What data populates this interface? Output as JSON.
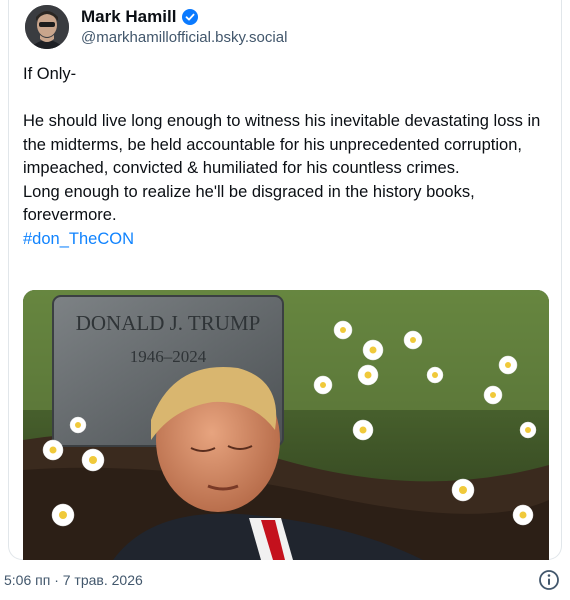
{
  "author": {
    "display_name": "Mark Hamill",
    "handle": "@markhamillofficial.bsky.social"
  },
  "post": {
    "line1": "If Only-",
    "paragraph": "He should live long enough to witness his inevitable devastating loss in the midterms, be held accountable for his unprecedented corruption, impeached, convicted & humiliated for his countless crimes.",
    "paragraph2": "Long enough to realize he'll be disgraced in the history books, forevermore.",
    "hashtag": "#don_TheCON"
  },
  "image": {
    "headstone_name": "DONALD J. TRUMP",
    "headstone_years": "1946–2024"
  },
  "footer": {
    "timestamp": "5:06 пп · 7 трав. 2026"
  },
  "icons": {
    "verified": "verified-badge-icon",
    "info": "info-icon"
  },
  "colors": {
    "link": "#1083fe",
    "verified": "#0a7aff",
    "secondary_text": "#42576c"
  }
}
